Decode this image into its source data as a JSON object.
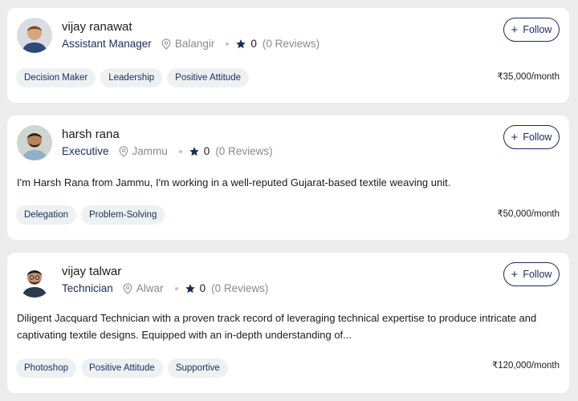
{
  "follow_label": "Follow",
  "profiles": [
    {
      "name": "vijay ranawat",
      "role": "Assistant Manager",
      "location": "Balangir",
      "rating": "0",
      "reviews": "(0 Reviews)",
      "bio": "",
      "tags": [
        "Decision Maker",
        "Leadership",
        "Positive Attitude"
      ],
      "salary": "₹35,000/month"
    },
    {
      "name": "harsh rana",
      "role": "Executive",
      "location": "Jammu",
      "rating": "0",
      "reviews": "(0 Reviews)",
      "bio": "I'm Harsh Rana from Jammu, I'm working in a well-reputed Gujarat-based textile weaving unit.",
      "tags": [
        "Delegation",
        "Problem-Solving"
      ],
      "salary": "₹50,000/month"
    },
    {
      "name": "vijay talwar",
      "role": "Technician",
      "location": "Alwar",
      "rating": "0",
      "reviews": "(0 Reviews)",
      "bio": "Diligent Jacquard Technician with a proven track record of leveraging technical expertise to produce intricate and captivating textile designs. Equipped with an in-depth understanding of...",
      "tags": [
        "Photoshop",
        "Positive Attitude",
        "Supportive"
      ],
      "salary": "₹120,000/month"
    }
  ],
  "colors": {
    "accent": "#1b2b5c",
    "muted": "#8a8a8a",
    "tag_bg": "#eef1f2",
    "page_bg": "#ececec"
  },
  "icons": {
    "location": "map-pin-icon",
    "rating": "star-icon",
    "follow": "plus-icon"
  }
}
